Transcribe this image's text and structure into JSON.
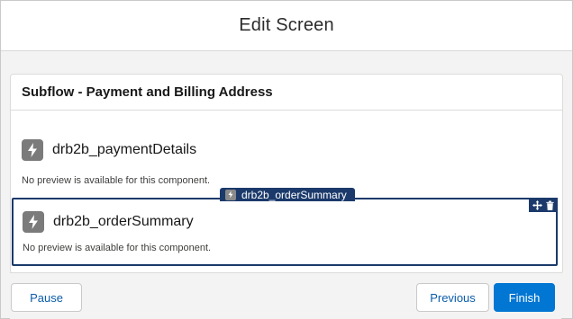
{
  "header": {
    "title": "Edit Screen"
  },
  "card": {
    "title": "Subflow - Payment and Billing Address",
    "components": [
      {
        "name": "drb2b_paymentDetails",
        "note": "No preview is available for this component."
      },
      {
        "name": "drb2b_orderSummary",
        "note": "No preview is available for this component."
      }
    ],
    "drag_label": "drb2b_orderSummary"
  },
  "footer": {
    "pause_label": "Pause",
    "previous_label": "Previous",
    "finish_label": "Finish"
  },
  "colors": {
    "brand": "#0176d3",
    "selection": "#1b3a6b",
    "icon_gray": "#7b7b7b"
  },
  "icons": [
    "lightning-icon",
    "move-icon",
    "trash-icon"
  ]
}
